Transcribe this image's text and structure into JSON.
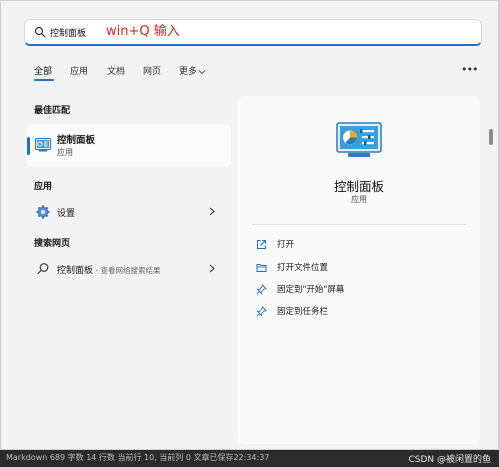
{
  "search": {
    "value": "控制面板"
  },
  "annotation": "win+Q 输入",
  "tabs": [
    {
      "label": "全部"
    },
    {
      "label": "应用"
    },
    {
      "label": "文档"
    },
    {
      "label": "网页"
    },
    {
      "label": "更多"
    }
  ],
  "sections": {
    "best_match": "最佳匹配",
    "apps": "应用",
    "web": "搜索网页"
  },
  "best_match": {
    "name": "控制面板",
    "type": "应用",
    "icon": "control-panel-icon"
  },
  "apps": [
    {
      "label": "设置",
      "icon": "gear-icon"
    }
  ],
  "web": [
    {
      "label": "控制面板",
      "sub": " - 查看网络搜索结果",
      "icon": "search-icon"
    }
  ],
  "detail": {
    "title": "控制面板",
    "type": "应用",
    "actions": [
      {
        "label": "打开",
        "icon": "open-icon"
      },
      {
        "label": "打开文件位置",
        "icon": "folder-icon"
      },
      {
        "label": "固定到\"开始\"屏幕",
        "icon": "pin-icon"
      },
      {
        "label": "固定到任务栏",
        "icon": "pin-icon"
      }
    ]
  },
  "status_bar": "Markdown  689 字数  14 行数  当前行 10, 当前列 0  文章已保存22:34:37",
  "watermark": "CSDN @被闲置的鱼",
  "colors": {
    "accent": "#1f6fd1",
    "annotation": "#e0261b"
  }
}
